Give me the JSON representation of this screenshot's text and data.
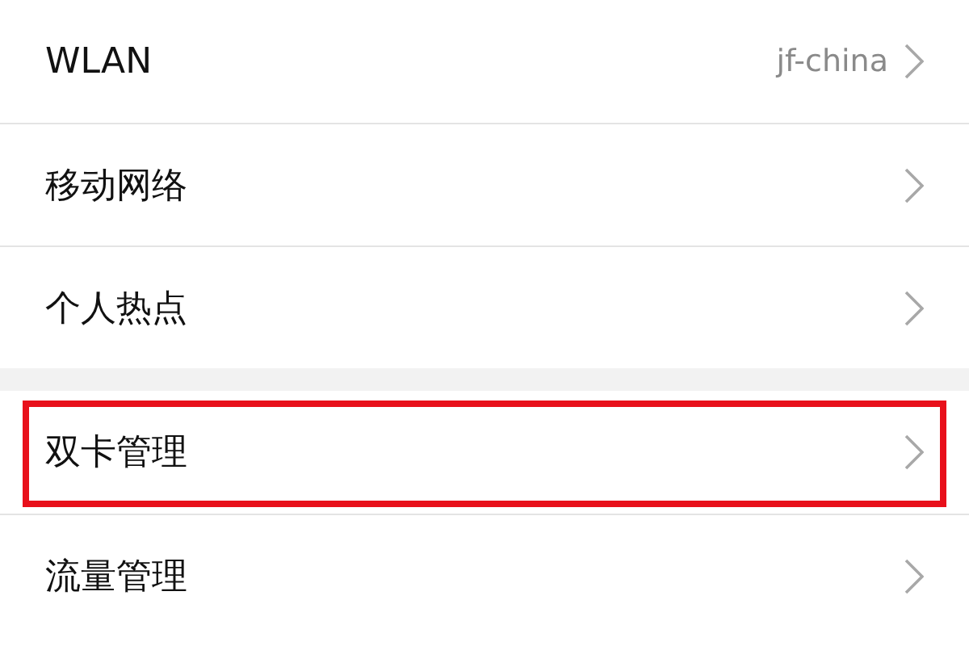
{
  "groups": [
    {
      "items": [
        {
          "label": "WLAN",
          "value": "jf-china",
          "highlighted": false
        },
        {
          "label": "移动网络",
          "highlighted": false
        },
        {
          "label": "个人热点",
          "highlighted": false
        }
      ]
    },
    {
      "items": [
        {
          "label": "双卡管理",
          "highlighted": true
        },
        {
          "label": "流量管理",
          "highlighted": false
        }
      ]
    }
  ]
}
